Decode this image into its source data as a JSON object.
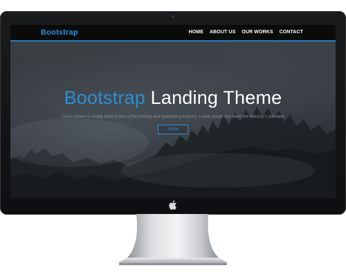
{
  "navbar": {
    "brand": "Bootstrap",
    "items": [
      {
        "label": "HOME"
      },
      {
        "label": "ABOUT US"
      },
      {
        "label": "OUR WORKS"
      },
      {
        "label": "CONTACT"
      }
    ]
  },
  "hero": {
    "title_accent": "Bootstrap",
    "title_rest": " Landing Theme",
    "subtitle": "Lorem Ipsum is simply dummy text of the printing and typesetting industry. Lorem Ipsum has been the industry's standard",
    "button_label": "Action"
  },
  "colors": {
    "accent": "#2b8fd6",
    "navbar_bg": "#0b0b0c",
    "bezel": "#111214"
  },
  "icons": {
    "chin_logo": "apple-logo-icon"
  }
}
